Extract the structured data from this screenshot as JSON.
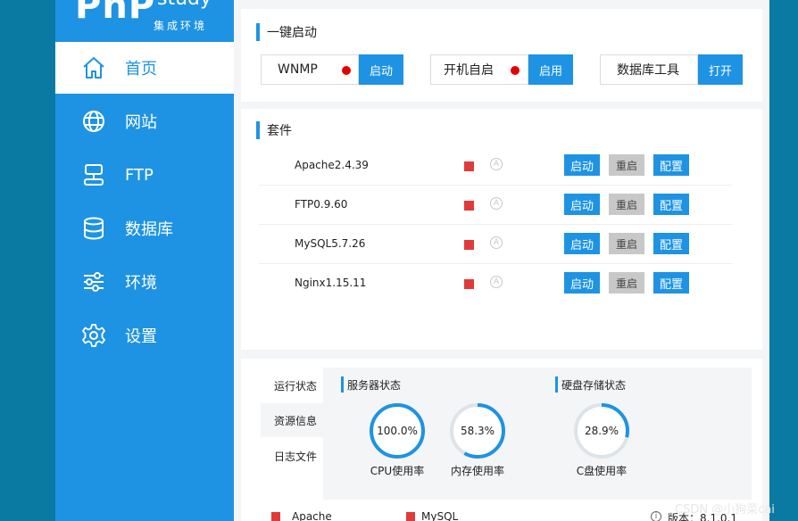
{
  "logo": {
    "php": "PhP",
    "study": "study",
    "subtitle": "集成环境"
  },
  "sidebar": {
    "items": [
      {
        "label": "首页",
        "icon": "home-icon",
        "active": true
      },
      {
        "label": "网站",
        "icon": "globe-icon"
      },
      {
        "label": "FTP",
        "icon": "server-icon"
      },
      {
        "label": "数据库",
        "icon": "database-icon"
      },
      {
        "label": "环境",
        "icon": "sliders-icon"
      },
      {
        "label": "设置",
        "icon": "gear-icon"
      }
    ]
  },
  "quick_start": {
    "title": "一键启动",
    "items": [
      {
        "label": "WNMP",
        "status_color": "#e60000",
        "button": "启动"
      },
      {
        "label": "开机自启",
        "status_color": "#e60000",
        "button": "启用"
      },
      {
        "label": "数据库工具",
        "button": "打开"
      }
    ]
  },
  "suite": {
    "title": "套件",
    "auto_symbol": "A",
    "services": [
      {
        "name": "Apache2.4.39",
        "start": "启动",
        "restart": "重启",
        "config": "配置"
      },
      {
        "name": "FTP0.9.60",
        "start": "启动",
        "restart": "重启",
        "config": "配置"
      },
      {
        "name": "MySQL5.7.26",
        "start": "启动",
        "restart": "重启",
        "config": "配置"
      },
      {
        "name": "Nginx1.15.11",
        "start": "启动",
        "restart": "重启",
        "config": "配置"
      }
    ]
  },
  "status_tabs": [
    "运行状态",
    "资源信息",
    "日志文件"
  ],
  "server_status": {
    "title": "服务器状态",
    "gauges": [
      {
        "value_text": "100.0%",
        "value": 100.0,
        "label": "CPU使用率"
      },
      {
        "value_text": "58.3%",
        "value": 58.3,
        "label": "内存使用率"
      }
    ]
  },
  "disk_status": {
    "title": "硬盘存储状态",
    "gauges": [
      {
        "value_text": "28.9%",
        "value": 28.9,
        "label": "C盘使用率"
      }
    ]
  },
  "bottom_bar": {
    "apache": "Apache",
    "mysql": "MySQL",
    "version": "版本：8.1.0.1"
  },
  "watermark": "CSDN @小狗菜cai",
  "colors": {
    "accent": "#1e93e3",
    "stopped": "#e03a3a",
    "restart_button": "#c8c8c8"
  }
}
